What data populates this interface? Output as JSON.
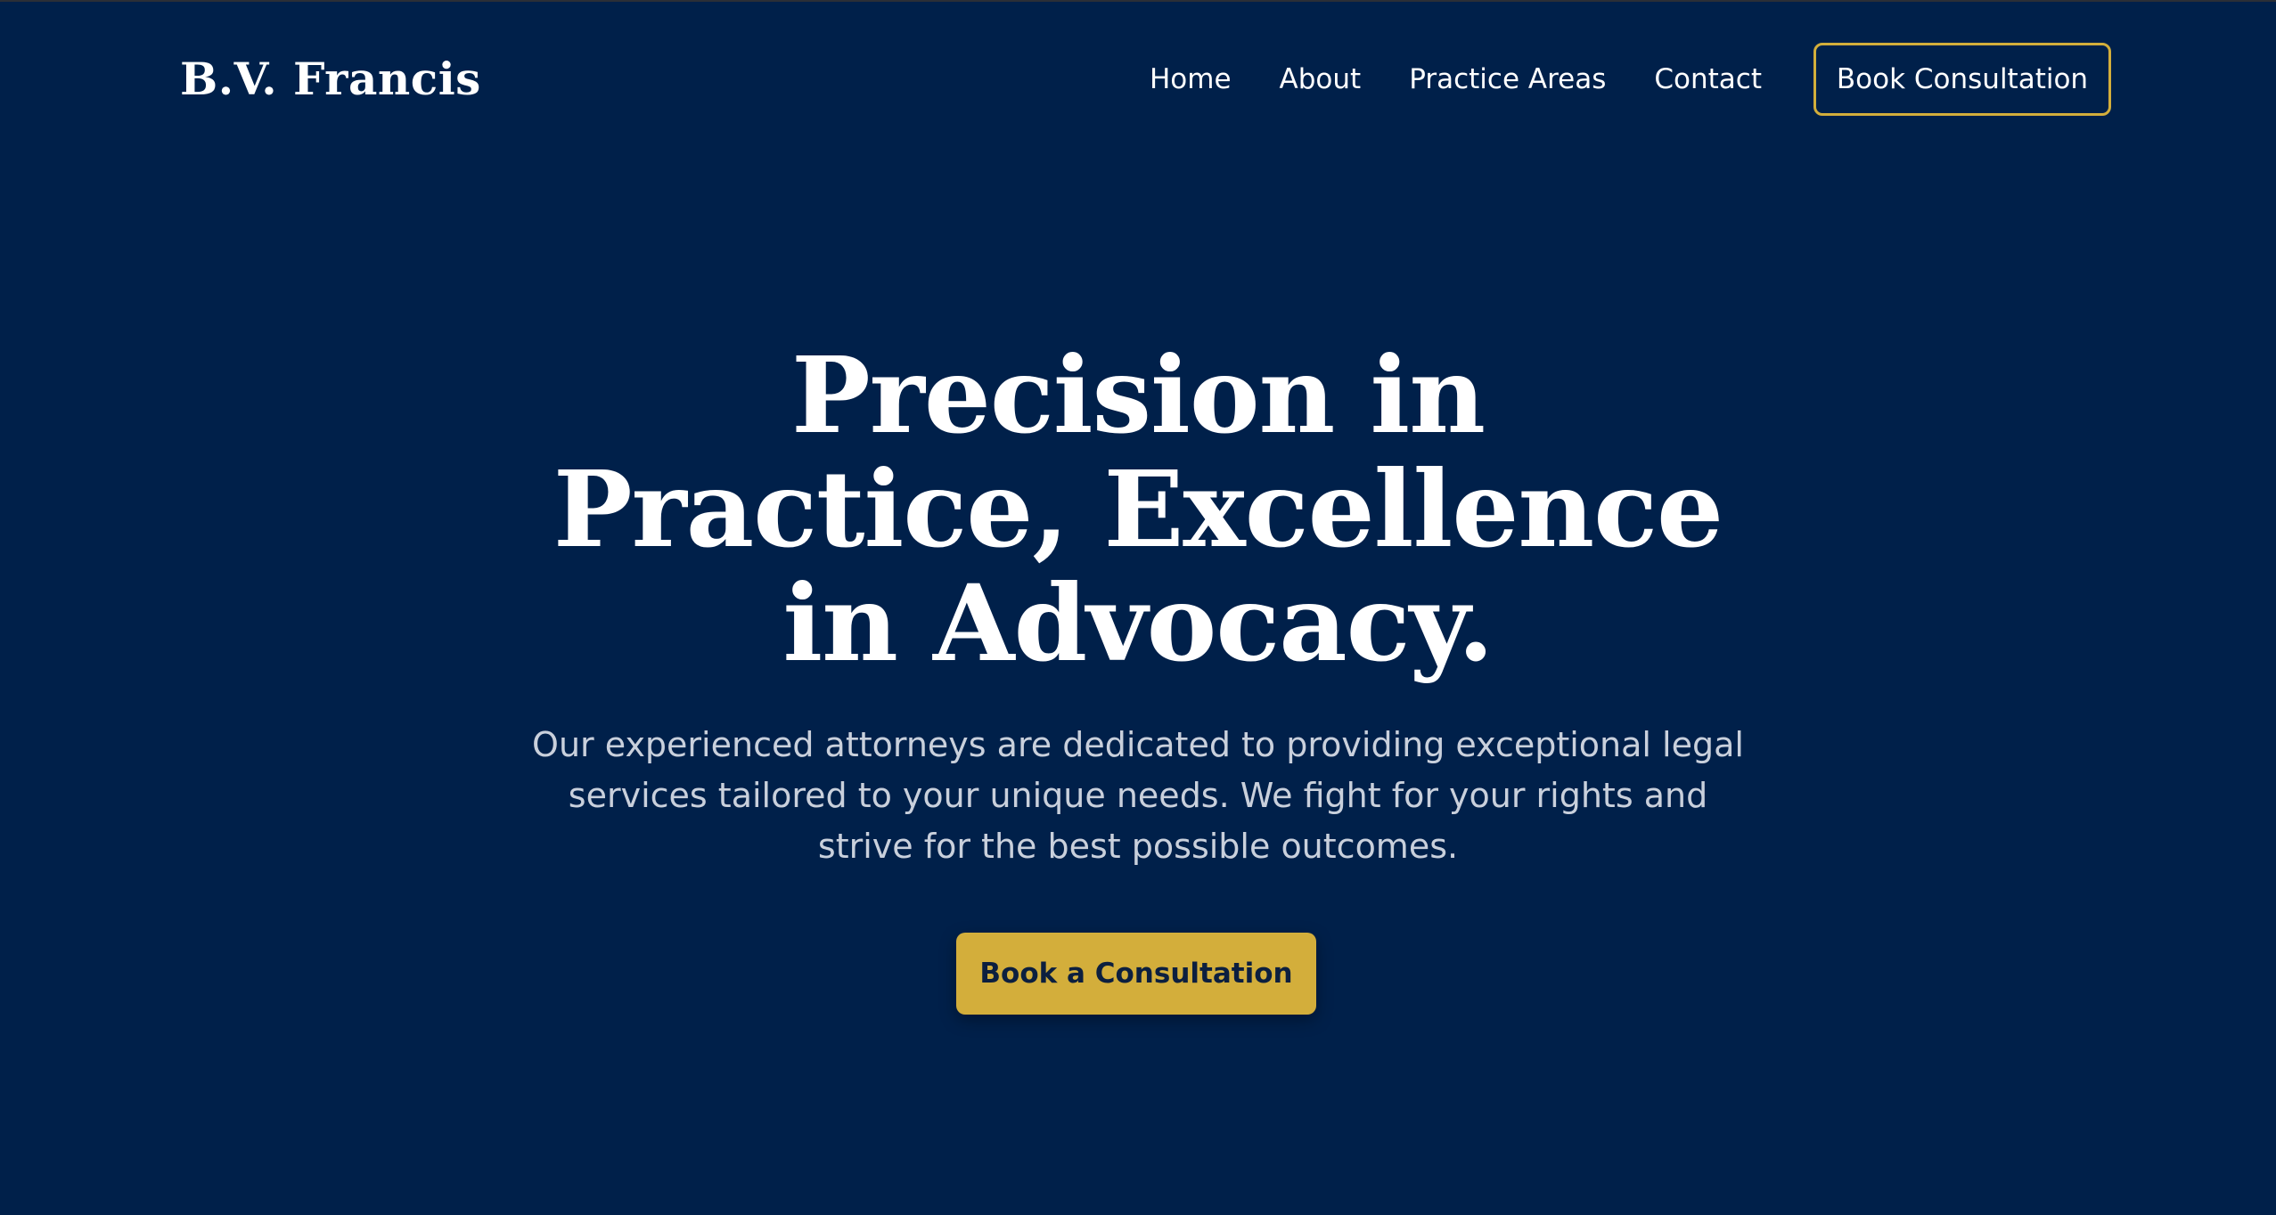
{
  "header": {
    "logo_text": "B.V. Francis",
    "nav": {
      "home": "Home",
      "about": "About",
      "practice_areas": "Practice Areas",
      "contact": "Contact"
    },
    "cta_label": "Book Consultation"
  },
  "hero": {
    "title_lines": [
      "Precision in",
      "Practice, Excellence",
      "in Advocacy."
    ],
    "subtitle_lines": [
      "Our experienced attorneys are dedicated to providing exceptional legal",
      "services tailored to your unique needs. We fight for your rights and",
      "strive for the best possible outcomes."
    ],
    "cta_label": "Book a Consultation"
  },
  "colors": {
    "background": "#00204a",
    "accent": "#d3ae3b",
    "text": "#ffffff",
    "muted_text": "#c9d0dc"
  }
}
